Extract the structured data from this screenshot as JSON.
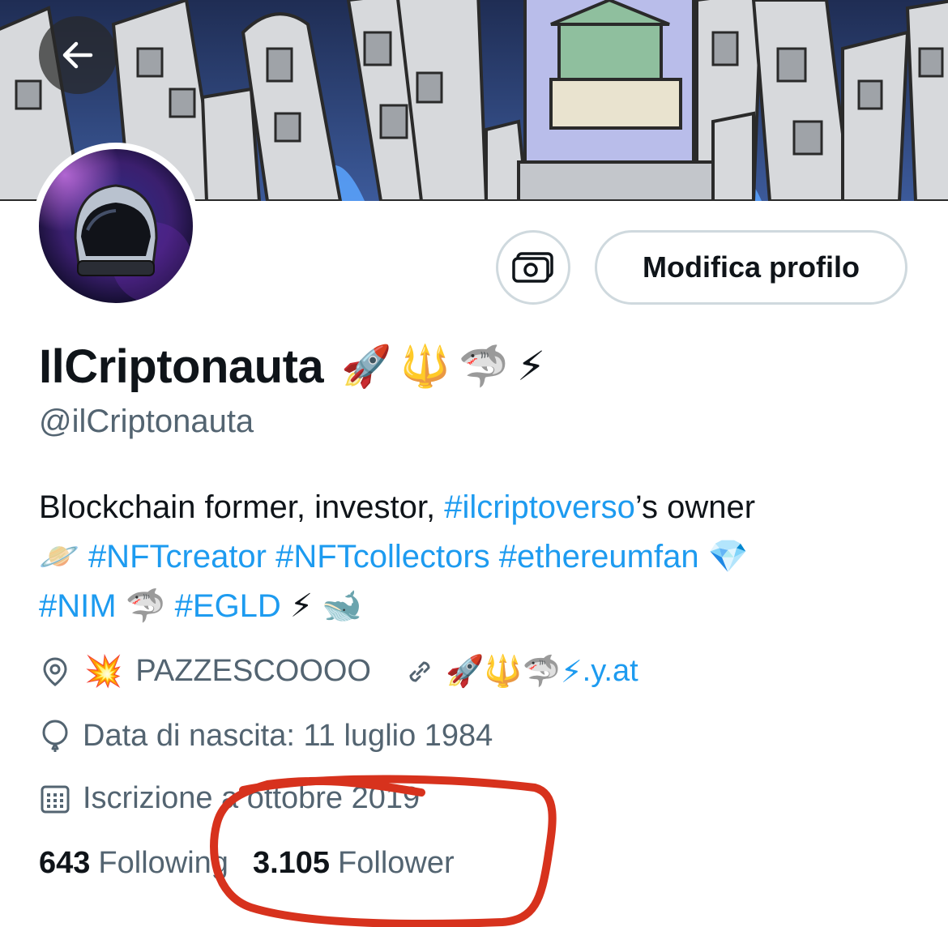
{
  "profile": {
    "display_name": "IlCriptonauta",
    "name_emojis": [
      "🚀",
      "🔱",
      "🦈",
      "⚡"
    ],
    "handle": "@ilCriptonauta",
    "edit_button_label": "Modifica profilo"
  },
  "bio": {
    "segments": [
      {
        "text": "Blockchain former, investor, ",
        "type": "text"
      },
      {
        "text": "#ilcriptoverso",
        "type": "hashtag"
      },
      {
        "text": "’s owner",
        "type": "text"
      },
      {
        "text": "🪐",
        "type": "emoji"
      },
      {
        "text": "#NFTcreator",
        "type": "hashtag"
      },
      {
        "text": "#NFTcollectors",
        "type": "hashtag"
      },
      {
        "text": "#ethereumfan",
        "type": "hashtag"
      },
      {
        "text": "💎",
        "type": "emoji"
      },
      {
        "text": "#NIM",
        "type": "hashtag"
      },
      {
        "text": "🦈",
        "type": "emoji"
      },
      {
        "text": "#EGLD",
        "type": "hashtag"
      },
      {
        "text": "⚡",
        "type": "emoji"
      },
      {
        "text": "🐋",
        "type": "emoji"
      }
    ]
  },
  "meta": {
    "location_emoji": "💥",
    "location": "PAZZESCOOOO",
    "website_emojis": [
      "🚀",
      "🔱",
      "🦈",
      "⚡"
    ],
    "website": ".y.at",
    "birthday": "Data di nascita: 11 luglio 1984",
    "joined": "Iscrizione a ottobre 2019"
  },
  "stats": {
    "following_count": "643",
    "following_label": "Following",
    "followers_count": "3.105",
    "followers_label": "Follower"
  },
  "icons": {
    "back": "arrow-left-icon",
    "camera": "camera-icon",
    "location": "location-pin-icon",
    "link": "link-icon",
    "birthday": "balloon-icon",
    "calendar": "calendar-icon"
  },
  "colors": {
    "link": "#1d9bf0",
    "secondary_text": "#536471",
    "annotation": "#d7321d"
  }
}
